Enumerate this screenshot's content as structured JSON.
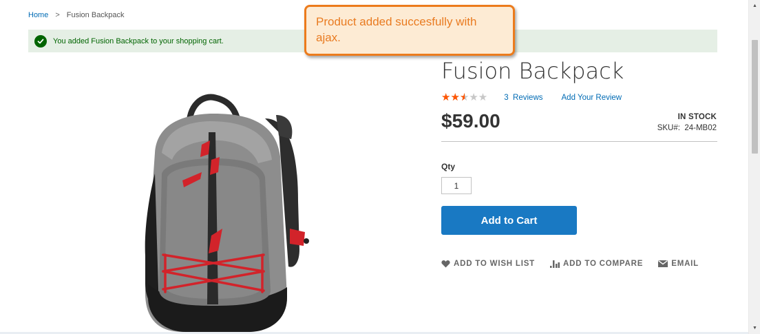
{
  "breadcrumb": {
    "home": "Home",
    "separator": ">",
    "current": "Fusion Backpack"
  },
  "message": {
    "text": "You added Fusion Backpack to your shopping cart.",
    "type": "success"
  },
  "callout": {
    "text": "Product added succesfully with ajax."
  },
  "product": {
    "name": "Fusion Backpack",
    "rating_fraction": 0.5,
    "review_count": "3",
    "reviews_label": "Reviews",
    "add_review_label": "Add Your Review",
    "price": "$59.00",
    "stock": "IN STOCK",
    "sku_label": "SKU#:",
    "sku": "24-MB02"
  },
  "form": {
    "qty_label": "Qty",
    "qty_value": "1",
    "add_to_cart_label": "Add to Cart"
  },
  "actions": {
    "wishlist": "ADD TO WISH LIST",
    "compare": "ADD TO COMPARE",
    "email": "EMAIL"
  },
  "colors": {
    "link": "#006bb4",
    "button": "#1979c3",
    "star": "#ff5501",
    "success_bg": "#e5efe5",
    "success_text": "#006400",
    "callout_border": "#ec7b1c"
  }
}
